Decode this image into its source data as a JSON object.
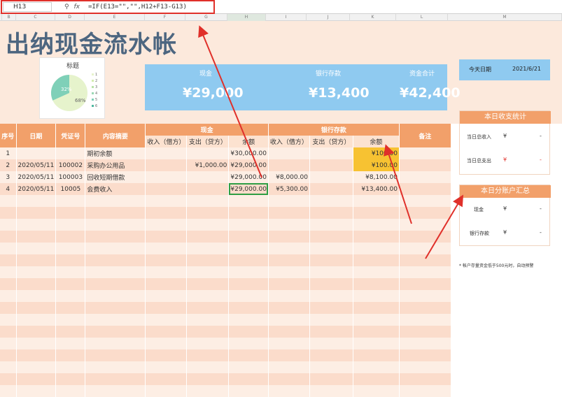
{
  "formula_bar": {
    "name_box": "H13",
    "fx": "fx",
    "formula": "=IF(E13=\"\",\"\",H12+F13-G13)"
  },
  "columns": [
    "B",
    "C",
    "D",
    "E",
    "F",
    "G",
    "H",
    "I",
    "J",
    "K",
    "L",
    "M"
  ],
  "title": "出纳现金流水帐",
  "pie": {
    "title": "标题",
    "slice_labels": [
      "32%",
      "68%"
    ],
    "legend": [
      "1",
      "2",
      "3",
      "4",
      "5",
      "6"
    ]
  },
  "summary": {
    "cash_label": "现金",
    "cash_value": "¥29,000",
    "bank_label": "银行存款",
    "bank_value": "¥13,400",
    "total_label": "资金合计",
    "total_value": "¥42,400"
  },
  "today": {
    "label": "今天日期",
    "value": "2021/6/21"
  },
  "table": {
    "h_seq": "序号",
    "h_date": "日期",
    "h_voucher": "凭证号",
    "h_desc": "内容摘要",
    "h_cash": "现金",
    "h_bank": "银行存款",
    "h_note": "备注",
    "h_in": "收入（借方）",
    "h_out": "支出（贷方）",
    "h_bal": "余额",
    "rows": [
      {
        "seq": "1",
        "date": "",
        "voucher": "",
        "desc": "期初余额",
        "cin": "",
        "cout": "",
        "cbal": "¥30,000.00",
        "bin": "",
        "bout": "",
        "bbal": "¥100.00"
      },
      {
        "seq": "2",
        "date": "2020/05/11",
        "voucher": "100002",
        "desc": "采购办公用品",
        "cin": "",
        "cout": "¥1,000.00",
        "cbal": "¥29,000.00",
        "bin": "",
        "bout": "",
        "bbal": "¥100.00"
      },
      {
        "seq": "3",
        "date": "2020/05/11",
        "voucher": "100003",
        "desc": "回收短期借款",
        "cin": "",
        "cout": "",
        "cbal": "¥29,000.00",
        "bin": "¥8,000.00",
        "bout": "",
        "bbal": "¥8,100.00"
      },
      {
        "seq": "4",
        "date": "2020/05/11",
        "voucher": "10005",
        "desc": "会费收入",
        "cin": "",
        "cout": "",
        "cbal": "¥29,000.00",
        "bin": "¥5,300.00",
        "bout": "",
        "bbal": "¥13,400.00"
      }
    ]
  },
  "daily_stats": {
    "title": "本日收支统计",
    "income_label": "当日总收入",
    "income_sym": "¥",
    "income_val": "-",
    "expense_label": "当日总支出",
    "expense_sym": "¥",
    "expense_val": "-"
  },
  "account_summary": {
    "title": "本日分账户汇总",
    "cash_label": "现金",
    "cash_sym": "¥",
    "cash_val": "-",
    "bank_label": "银行存款",
    "bank_sym": "¥",
    "bank_val": "-"
  },
  "note": "* 帐户存量资金低于500元时，自动预警",
  "colors": {
    "accent": "#f2a06a",
    "blue": "#8fcaf0",
    "title": "#4d6680",
    "highlight": "#f7c232",
    "arrow": "#e0302a"
  }
}
